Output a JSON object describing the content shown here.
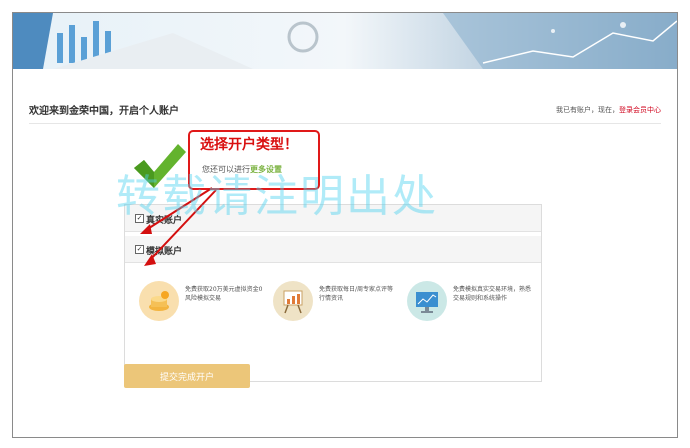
{
  "header": {
    "welcome_title": "欢迎来到金荣中国，开启个人账户",
    "login_hint_prefix": "我已有账户，现在",
    "login_link": "登录会员中心"
  },
  "callout": {
    "title": "选择开户类型！",
    "sub_prefix": "您还可以进行",
    "sub_link": "更多设置"
  },
  "options": [
    {
      "label": "真实账户",
      "checked": true
    },
    {
      "label": "模拟账户",
      "checked": true
    }
  ],
  "features": [
    {
      "icon": "coins-icon",
      "text": "免费获取20万美元虚拟资金0风险模拟交易",
      "color": "#f9dfae"
    },
    {
      "icon": "easel-chart-icon",
      "text": "免费获取每日/周专家点评等行情资讯",
      "color": "#efe3c6"
    },
    {
      "icon": "monitor-icon",
      "text": "免费模拟真实交易环境，熟悉交易规则和系统操作",
      "color": "#cbe8e6"
    }
  ],
  "submit_label": "提交完成开户",
  "watermark": "转载请注明出处"
}
